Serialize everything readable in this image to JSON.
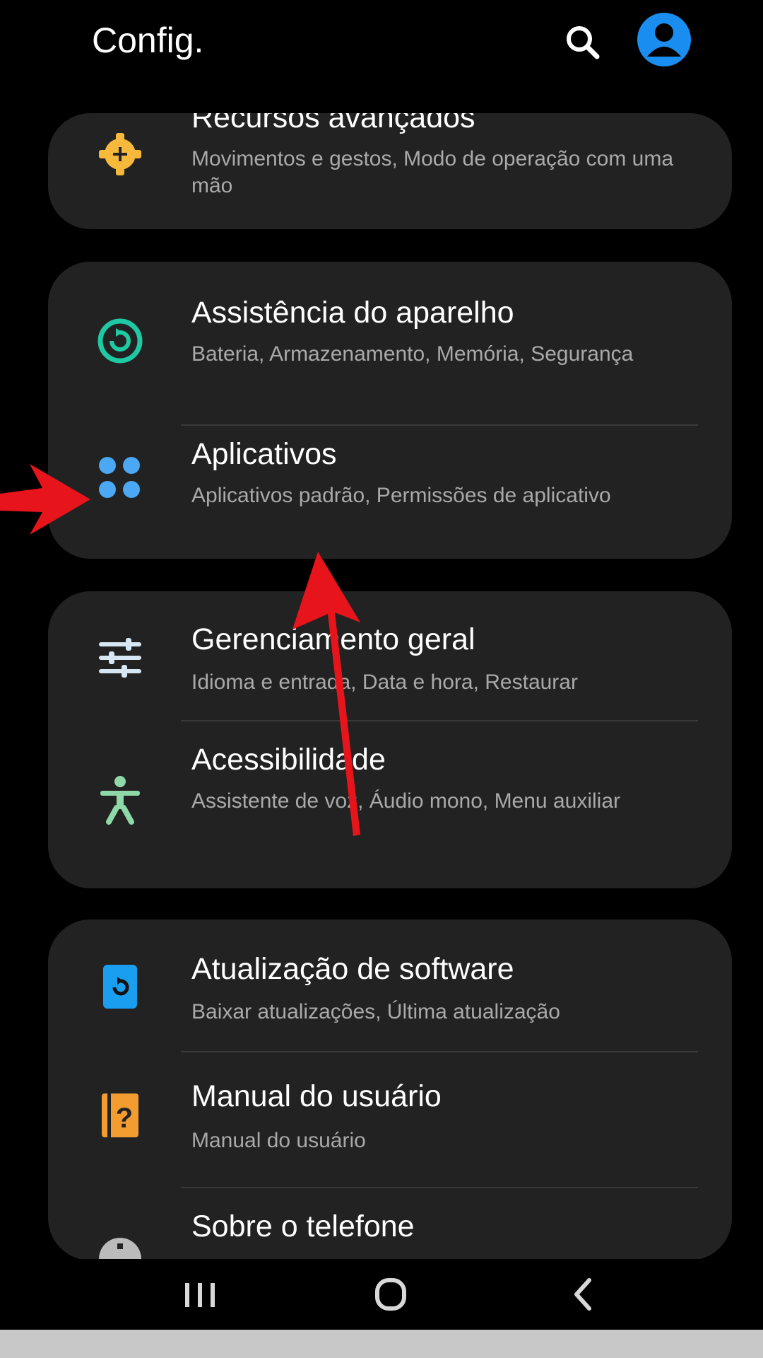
{
  "header": {
    "title": "Config."
  },
  "settings": [
    {
      "title": "Recursos avançados",
      "subtitle": "Movimentos e gestos, Modo de operação com uma mão",
      "icon": "advanced-features-icon",
      "icon_color": "#f6b93b"
    },
    {
      "title": "Assistência do aparelho",
      "subtitle": "Bateria, Armazenamento, Memória, Segurança",
      "icon": "device-care-icon",
      "icon_color": "#1ec9a4"
    },
    {
      "title": "Aplicativos",
      "subtitle": "Aplicativos padrão, Permissões de aplicativo",
      "icon": "apps-icon",
      "icon_color": "#4aa8f5"
    },
    {
      "title": "Gerenciamento geral",
      "subtitle": "Idioma e entrada, Data e hora, Restaurar",
      "icon": "general-management-icon",
      "icon_color": "#d6e6f2"
    },
    {
      "title": "Acessibilidade",
      "subtitle": "Assistente de voz, Áudio mono, Menu auxiliar",
      "icon": "accessibility-icon",
      "icon_color": "#8fd9a8"
    },
    {
      "title": "Atualização de software",
      "subtitle": "Baixar atualizações, Última atualização",
      "icon": "software-update-icon",
      "icon_color": "#1a9ef0"
    },
    {
      "title": "Manual do usuário",
      "subtitle": "Manual do usuário",
      "icon": "user-manual-icon",
      "icon_color": "#f39c2f"
    },
    {
      "title": "Sobre o telefone",
      "subtitle": "",
      "icon": "about-phone-icon",
      "icon_color": "#bbbbbb"
    }
  ],
  "navbar": {
    "buttons": [
      "recent-apps",
      "home",
      "back"
    ]
  },
  "annotation_color": "#e8141b"
}
